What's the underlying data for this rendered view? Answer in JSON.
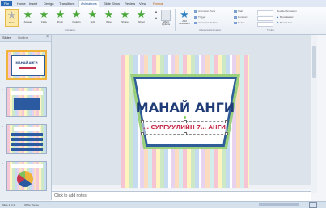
{
  "tabs": [
    "File",
    "Home",
    "Insert",
    "Design",
    "Transitions",
    "Animations",
    "Slide Show",
    "Review",
    "View",
    "Format"
  ],
  "active_tab": "Animations",
  "ribbon": {
    "gallery": [
      "None",
      "Appear",
      "Fade",
      "Fly In",
      "Float In",
      "Split",
      "Wipe",
      "Shape",
      "Wheel"
    ],
    "effect_options": "Effect Options",
    "add_animation": "Add Animation",
    "animation_pane": "Animation Pane",
    "trigger": "Trigger",
    "animation_painter": "Animation Painter",
    "start": "Start:",
    "duration": "Duration:",
    "delay": "Delay:",
    "reorder": "Reorder Animation",
    "move_earlier": "Move Earlier",
    "move_later": "Move Later",
    "group_animation": "Animation",
    "group_advanced": "Advanced Animation",
    "group_timing": "Timing"
  },
  "slides_panel": {
    "tabs": [
      "Slides",
      "Outline"
    ],
    "thumbnails": [
      {
        "num": "1",
        "title": "МАНАЙ АНГИ"
      },
      {
        "num": "2",
        "title": ""
      },
      {
        "num": "3",
        "title": ""
      },
      {
        "num": "4",
        "title": ""
      }
    ]
  },
  "slide": {
    "title": "МАНАЙ АНГИ",
    "subtitle": "… СУРГУУЛИЙН  7… АНГИ"
  },
  "notes_placeholder": "Click to add notes",
  "status": {
    "left": "Slide 1 of 4",
    "theme": "Office Theme"
  },
  "colors": {
    "title": "#1f3c78",
    "subtitle": "#c93350",
    "frame_blue": "#2f5d9a",
    "frame_green": "#9bd07e"
  }
}
